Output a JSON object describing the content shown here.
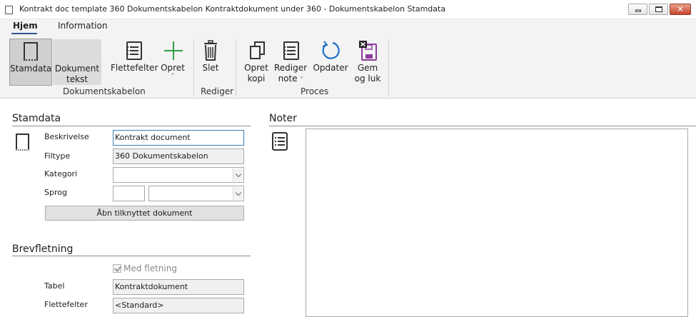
{
  "window": {
    "title": "Kontrakt doc template 360 Dokumentskabelon Kontraktdokument under 360 - Dokumentskabelon Stamdata"
  },
  "ribbon": {
    "tabs": [
      {
        "label": "Hjem",
        "active": true
      },
      {
        "label": "Information",
        "active": false
      }
    ],
    "buttons": {
      "stamdata": "Stamdata",
      "dokument_tekst_1": "Dokument",
      "dokument_tekst_2": "tekst",
      "flettefelter": "Flettefelter",
      "opret": "Opret",
      "slet": "Slet",
      "opret_kopi_1": "Opret",
      "opret_kopi_2": "kopi",
      "rediger_note_1": "Rediger",
      "rediger_note_2": "note",
      "opdater": "Opdater",
      "gem_og_luk_1": "Gem",
      "gem_og_luk_2": "og luk"
    },
    "groups": {
      "dokumentskabelon": "Dokumentskabelon",
      "rediger": "Rediger",
      "proces": "Proces"
    }
  },
  "stamdata": {
    "title": "Stamdata",
    "beskrivelse_label": "Beskrivelse",
    "beskrivelse_value": "Kontrakt document",
    "filtype_label": "Filtype",
    "filtype_value": "360 Dokumentskabelon",
    "kategori_label": "Kategori",
    "kategori_value": "",
    "sprog_label": "Sprog",
    "sprog_code": "",
    "sprog_value": "",
    "open_button": "Åbn tilknyttet dokument"
  },
  "brevfletning": {
    "title": "Brevfletning",
    "med_fletning_label": "Med fletning",
    "med_fletning_checked": true,
    "tabel_label": "Tabel",
    "tabel_value": "Kontraktdokument",
    "flettefelter_label": "Flettefelter",
    "flettefelter_value": "<Standard>"
  },
  "noter": {
    "title": "Noter",
    "content": ""
  },
  "colors": {
    "accent": "#2b5797",
    "plus_green": "#2e9e45",
    "refresh_blue": "#1e6fc8",
    "save_purple": "#8e3a9e"
  }
}
